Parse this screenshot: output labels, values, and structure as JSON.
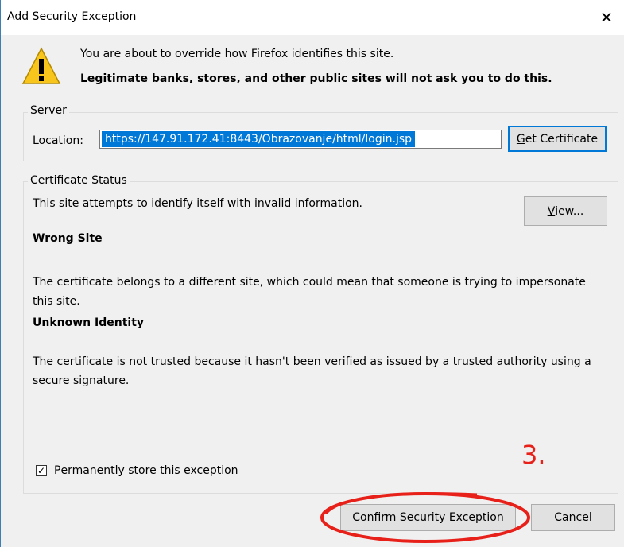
{
  "window": {
    "title": "Add Security Exception",
    "close_glyph": "✕"
  },
  "warning": {
    "icon": "warning-triangle-icon",
    "line1": "You are about to override how Firefox identifies this site.",
    "line2": "Legitimate banks, stores, and other public sites will not ask you to do this."
  },
  "server": {
    "legend": "Server",
    "location_label": "Location:",
    "location_value": "https://147.91.172.41:8443/Obrazovanje/html/login.jsp",
    "get_cert_accel": "G",
    "get_cert_rest": "et Certificate"
  },
  "status": {
    "legend": "Certificate Status",
    "summary": "This site attempts to identify itself with invalid information.",
    "view_accel": "V",
    "view_rest": "iew...",
    "wrong_site_title": "Wrong Site",
    "wrong_site_desc": "The certificate belongs to a different site, which could mean that someone is trying to impersonate this site.",
    "unknown_title": "Unknown Identity",
    "unknown_desc": "The certificate is not trusted because it hasn't been verified as issued by a trusted authority using a secure signature."
  },
  "permanent": {
    "checked": true,
    "check_glyph": "✓",
    "accel": "P",
    "rest": "ermanently store this exception"
  },
  "annotation": {
    "label": "3.",
    "color": "#e8201a"
  },
  "buttons": {
    "confirm_accel": "C",
    "confirm_rest": "onfirm Security Exception",
    "cancel": "Cancel"
  },
  "colors": {
    "accent": "#0078d7",
    "dialog_bg": "#f0f0f0",
    "annotation_red": "#e8201a"
  }
}
